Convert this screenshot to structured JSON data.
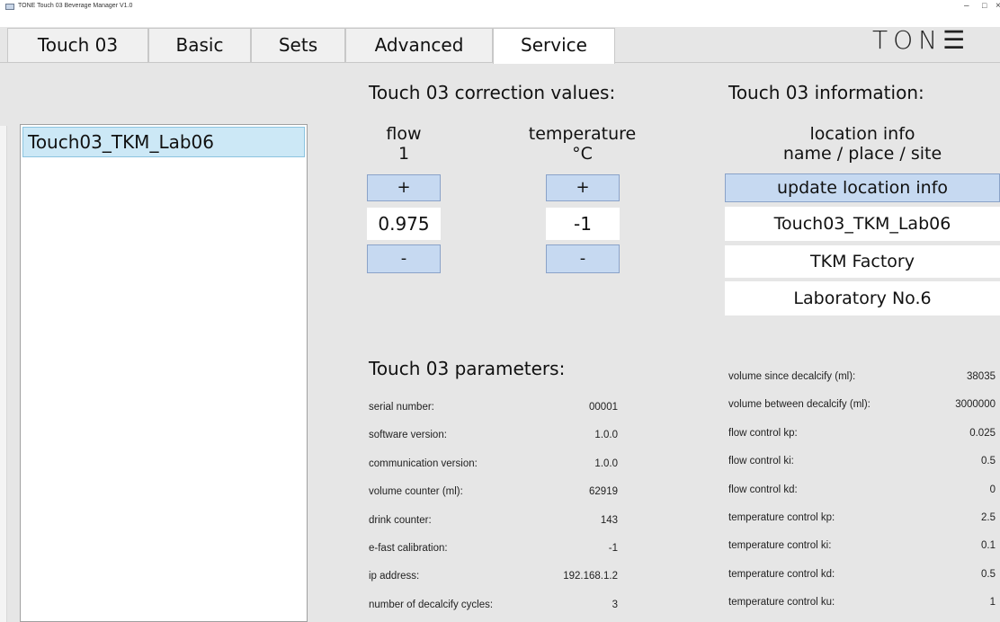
{
  "window": {
    "title": "TONE Touch 03   Beverage Manager   V1.0",
    "controls": {
      "minimize": "–",
      "maximize": "□",
      "close": "×"
    }
  },
  "tabs": [
    {
      "label": "Touch 03"
    },
    {
      "label": "Basic"
    },
    {
      "label": "Sets"
    },
    {
      "label": "Advanced"
    },
    {
      "label": "Service",
      "active": true
    }
  ],
  "logo": "TON☰",
  "devices": [
    "Touch03_TKM_Lab06"
  ],
  "correction": {
    "heading": "Touch 03 correction values:",
    "flow": {
      "label": "flow",
      "unit": "1",
      "plus": "+",
      "minus": "-",
      "value": "0.975"
    },
    "temperature": {
      "label": "temperature",
      "unit": "°C",
      "plus": "+",
      "minus": "-",
      "value": "-1"
    }
  },
  "information": {
    "heading": "Touch 03 information:",
    "label_line1": "location info",
    "label_line2": "name / place / site",
    "update_button": "update location info",
    "fields": [
      "Touch03_TKM_Lab06",
      "TKM Factory",
      "Laboratory No.6"
    ]
  },
  "parameters": {
    "heading": "Touch 03 parameters:",
    "left": [
      {
        "label": "serial number:",
        "value": "00001"
      },
      {
        "label": "software version:",
        "value": "1.0.0"
      },
      {
        "label": "communication version:",
        "value": "1.0.0"
      },
      {
        "label": "volume counter (ml):",
        "value": "62919"
      },
      {
        "label": "drink counter:",
        "value": "143"
      },
      {
        "label": "e-fast calibration:",
        "value": "-1"
      },
      {
        "label": "ip address:",
        "value": "192.168.1.2"
      },
      {
        "label": "number of decalcify cycles:",
        "value": "3"
      }
    ],
    "right": [
      {
        "label": "volume since decalcify (ml):",
        "value": "38035"
      },
      {
        "label": "volume between decalcify (ml):",
        "value": "3000000"
      },
      {
        "label": "flow control kp:",
        "value": "0.025"
      },
      {
        "label": "flow control ki:",
        "value": "0.5"
      },
      {
        "label": "flow control kd:",
        "value": "0"
      },
      {
        "label": "temperature control kp:",
        "value": "2.5"
      },
      {
        "label": "temperature control ki:",
        "value": "0.1"
      },
      {
        "label": "temperature control kd:",
        "value": "0.5"
      },
      {
        "label": "temperature control ku:",
        "value": "1"
      }
    ]
  }
}
